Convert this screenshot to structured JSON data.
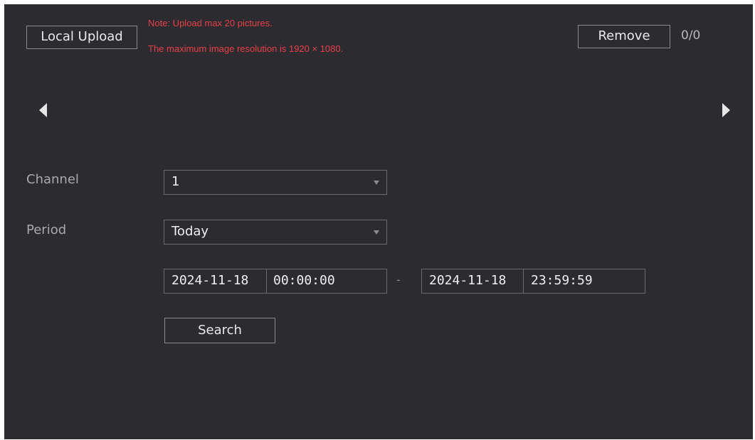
{
  "toolbar": {
    "local_upload_label": "Local Upload",
    "remove_label": "Remove",
    "counter": "0/0"
  },
  "notes": {
    "line1": "Note: Upload max 20 pictures.",
    "line2": "The maximum image resolution is 1920 × 1080."
  },
  "carousel": {
    "prev_icon": "triangle-left-icon",
    "next_icon": "triangle-right-icon"
  },
  "form": {
    "channel_label": "Channel",
    "channel_value": "1",
    "period_label": "Period",
    "period_value": "Today",
    "start_date": "2024-11-18",
    "start_time": "00:00:00",
    "range_separator": "-",
    "end_date": "2024-11-18",
    "end_time": "23:59:59",
    "search_label": "Search"
  },
  "colors": {
    "panel_bg": "#2b2b30",
    "note_red": "#e8404a",
    "text_light": "#eaeaea",
    "label_grey": "#a9a9ad"
  }
}
